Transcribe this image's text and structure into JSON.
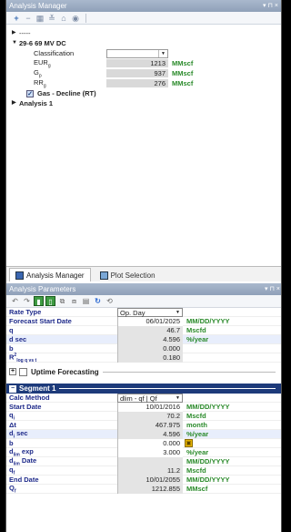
{
  "window": {
    "title": "Analysis Manager",
    "controls": "▾ ⊓ ×"
  },
  "toolbar": {
    "icons": [
      "plus-icon",
      "minus-icon",
      "grid-icon",
      "collapse-icon",
      "home-icon",
      "locate-icon"
    ]
  },
  "tree": {
    "root_label": "-----",
    "well_label": "29-6 69 MV DC",
    "props": [
      {
        "label": "Classification",
        "value": "",
        "unit": "",
        "type": "select"
      },
      {
        "label": "EURg",
        "value": "1213",
        "unit": "MMscf"
      },
      {
        "label": "Gp",
        "value": "937",
        "unit": "MMscf"
      },
      {
        "label": "RRg",
        "value": "276",
        "unit": "MMscf"
      }
    ],
    "checked_item": "Gas - Decline (RT)",
    "analysis_label": "Analysis 1"
  },
  "tabs": [
    {
      "label": "Analysis Manager",
      "active": true
    },
    {
      "label": "Plot Selection",
      "active": false
    }
  ],
  "params": {
    "title": "Analysis Parameters",
    "rows": [
      {
        "label": "Rate Type",
        "value": "Op. Day",
        "unit": "",
        "kind": "select"
      },
      {
        "label": "Forecast Start Date",
        "value": "06/01/2025",
        "unit": "MM/DD/YYYY",
        "kind": "white"
      },
      {
        "label": "q",
        "value": "46.7",
        "unit": "Mscfd",
        "kind": "grey"
      },
      {
        "label": "d sec",
        "value": "4.596",
        "unit": "%/year",
        "kind": "grey",
        "highlight": true
      },
      {
        "label": "b",
        "value": "0.000",
        "unit": "",
        "kind": "grey"
      },
      {
        "label": "R²log q vs t",
        "value": "0.180",
        "unit": "",
        "kind": "grey"
      }
    ],
    "uptime_label": "Uptime Forecasting"
  },
  "segment": {
    "title": "Segment 1",
    "rows": [
      {
        "label": "Calc Method",
        "value": "dlim - qf | Qf",
        "unit": "",
        "kind": "select"
      },
      {
        "label": "Start Date",
        "value": "10/01/2016",
        "unit": "MM/DD/YYYY",
        "kind": "white"
      },
      {
        "label": "qi",
        "value": "70.2",
        "unit": "Mscfd",
        "kind": "grey"
      },
      {
        "label": "Δt",
        "value": "467.975",
        "unit": "month",
        "kind": "grey"
      },
      {
        "label": "di sec",
        "value": "4.596",
        "unit": "%/year",
        "kind": "grey",
        "highlight": true
      },
      {
        "label": "b",
        "value": "0.000",
        "unit": "",
        "kind": "white",
        "lock": true
      },
      {
        "label": "dlim exp",
        "value": "3.000",
        "unit": "%/year",
        "kind": "white"
      },
      {
        "label": "dlim Date",
        "value": "",
        "unit": "MM/DD/YYYY",
        "kind": "grey"
      },
      {
        "label": "qf",
        "value": "11.2",
        "unit": "Mscfd",
        "kind": "grey"
      },
      {
        "label": "End Date",
        "value": "10/01/2055",
        "unit": "MM/DD/YYYY",
        "kind": "grey"
      },
      {
        "label": "Qf",
        "value": "1212.855",
        "unit": "MMscf",
        "kind": "grey"
      }
    ]
  },
  "colors": {
    "title_bar": "#98a8bf",
    "label_blue": "#1e2a8a",
    "unit_green": "#2a8a2a",
    "segment_bar": "#1d3a7a"
  }
}
